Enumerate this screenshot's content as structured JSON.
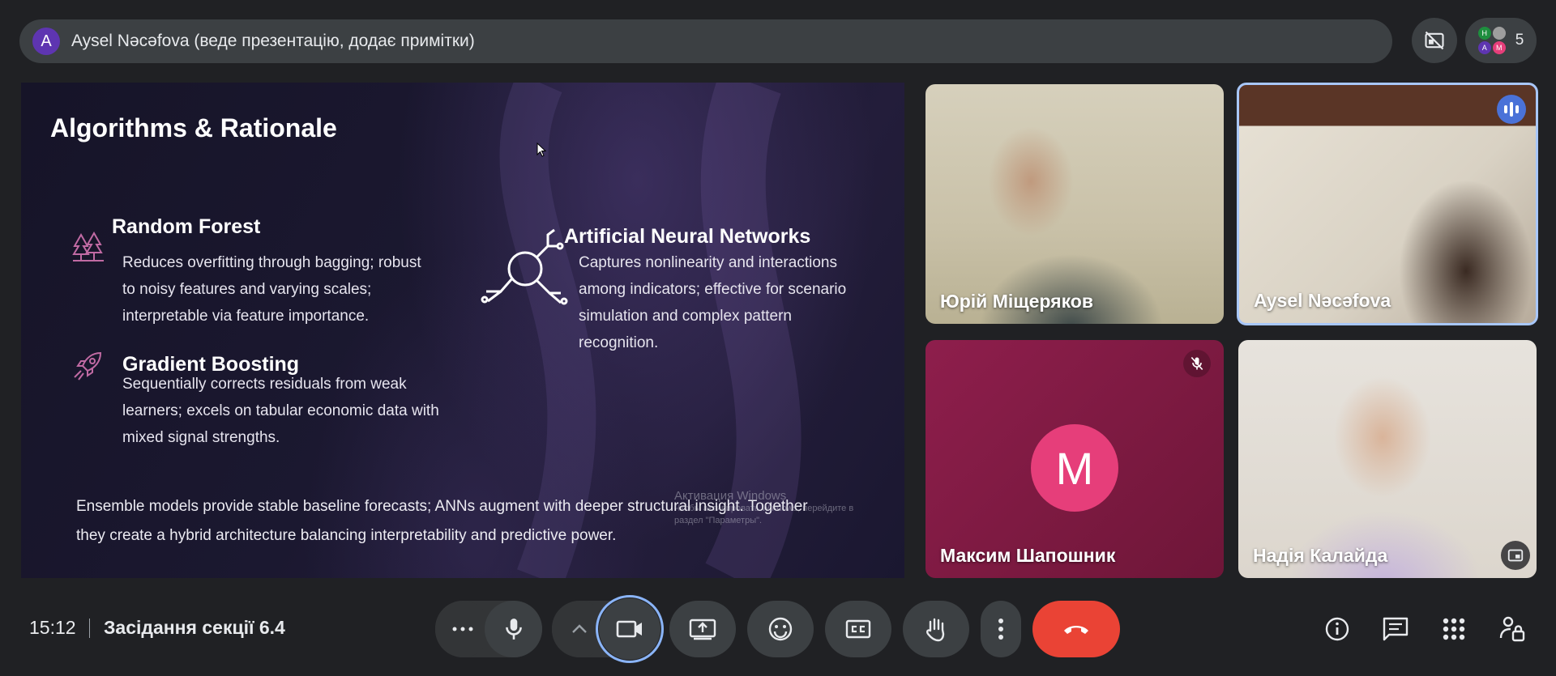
{
  "presenter_bar": {
    "avatar_letter": "A",
    "text": "Aysel Nəcəfova (веде презентацію, додає примітки)"
  },
  "people": {
    "count": "5",
    "mini_avatars": [
      "H",
      "A",
      "M"
    ]
  },
  "slide": {
    "title": "Algorithms & Rationale",
    "sections": [
      {
        "heading": "Random Forest",
        "lines": [
          "Reduces overfitting through bagging; robust",
          "to noisy features and varying scales;",
          "interpretable via feature importance."
        ]
      },
      {
        "heading": "Gradient Boosting",
        "lines": [
          "Sequentially corrects residuals from weak",
          "learners; excels on tabular economic data with",
          "mixed signal strengths."
        ]
      },
      {
        "heading": "Artificial Neural Networks",
        "lines": [
          "Captures nonlinearity and interactions",
          "among indicators; effective for scenario",
          "simulation and complex pattern",
          "recognition."
        ]
      }
    ],
    "summary_lines": [
      " Ensemble models provide stable baseline forecasts; ANNs augment with deeper structural insight. Together",
      "they create a hybrid architecture balancing interpretability and predictive power."
    ],
    "watermark": {
      "line1": "Активация Windows",
      "line2": "Чтобы активировать Windows, перейдите в",
      "line3": "раздел \"Параметры\"."
    }
  },
  "participants": [
    {
      "name": "Юрій Міщеряков"
    },
    {
      "name": "Aysel Nəcəfova",
      "speaking": true
    },
    {
      "name": "Максим Шапошник",
      "avatar_letter": "M",
      "muted": true
    },
    {
      "name": "Надія Калайда"
    }
  ],
  "meeting": {
    "time": "15:12",
    "name": "Засідання секції 6.4"
  },
  "colors": {
    "accent": "#8ab4f8",
    "hangup": "#ea4335",
    "bar": "#3c4043",
    "avatar_pink": "#e63e7a",
    "presenter_avatar": "#5e35b1"
  }
}
